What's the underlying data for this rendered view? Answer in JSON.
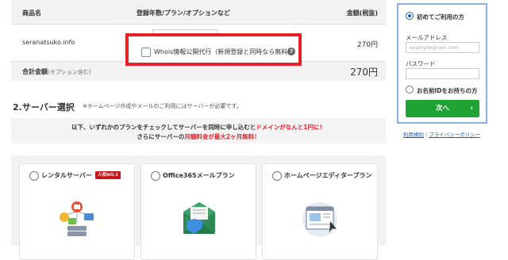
{
  "order_table": {
    "headers": {
      "product": "商品名",
      "options": "登録年数/プラン/オプションなど",
      "price": "金額(税抜)"
    },
    "item": {
      "domain": "seranatsuko.info",
      "price": "270円"
    },
    "whois_option": {
      "label": "Whois情報公開代行（新規登録と同時なら無料）",
      "help": "?",
      "checked": false
    },
    "total": {
      "label": "合計金額",
      "note": "(オプション含む)",
      "amount": "270円"
    }
  },
  "server_section": {
    "title": "2.サーバー選択",
    "note": "※ホームページ作成やメールのご利用にはサーバーが必要です。",
    "promo": {
      "line1_a": "以下、いずれかのプランをチェックしてサーバーを同時に申し込むと",
      "line1_b": "ドメインがなんと1円に！",
      "line2_a": "さらにサーバーの",
      "line2_b": "月額料金が最大2ヶ月無料！"
    },
    "plans": [
      {
        "name": "レンタルサーバー",
        "badge": "人気NO.1",
        "icon": "server-network-icon"
      },
      {
        "name": "Office365メールプラン",
        "icon": "mail-shield-icon"
      },
      {
        "name": "ホームページエディタープラン",
        "icon": "web-editor-icon"
      }
    ]
  },
  "login": {
    "first_time": "初めてご利用の方",
    "email_label": "メールアドレス",
    "email_placeholder": "example@xxx.com",
    "password_label": "パスワード",
    "has_id": "お名前IDをお持ちの方",
    "next_button": "次へ",
    "next_arrow": "›"
  },
  "footer": {
    "terms": "利用規約",
    "separator": "|",
    "privacy": "プライバシーポリシー"
  },
  "colors": {
    "highlight_red": "#e8202a",
    "primary_green": "#1fa335",
    "panel_border": "#8aaede",
    "link_blue": "#1f5fa8"
  }
}
